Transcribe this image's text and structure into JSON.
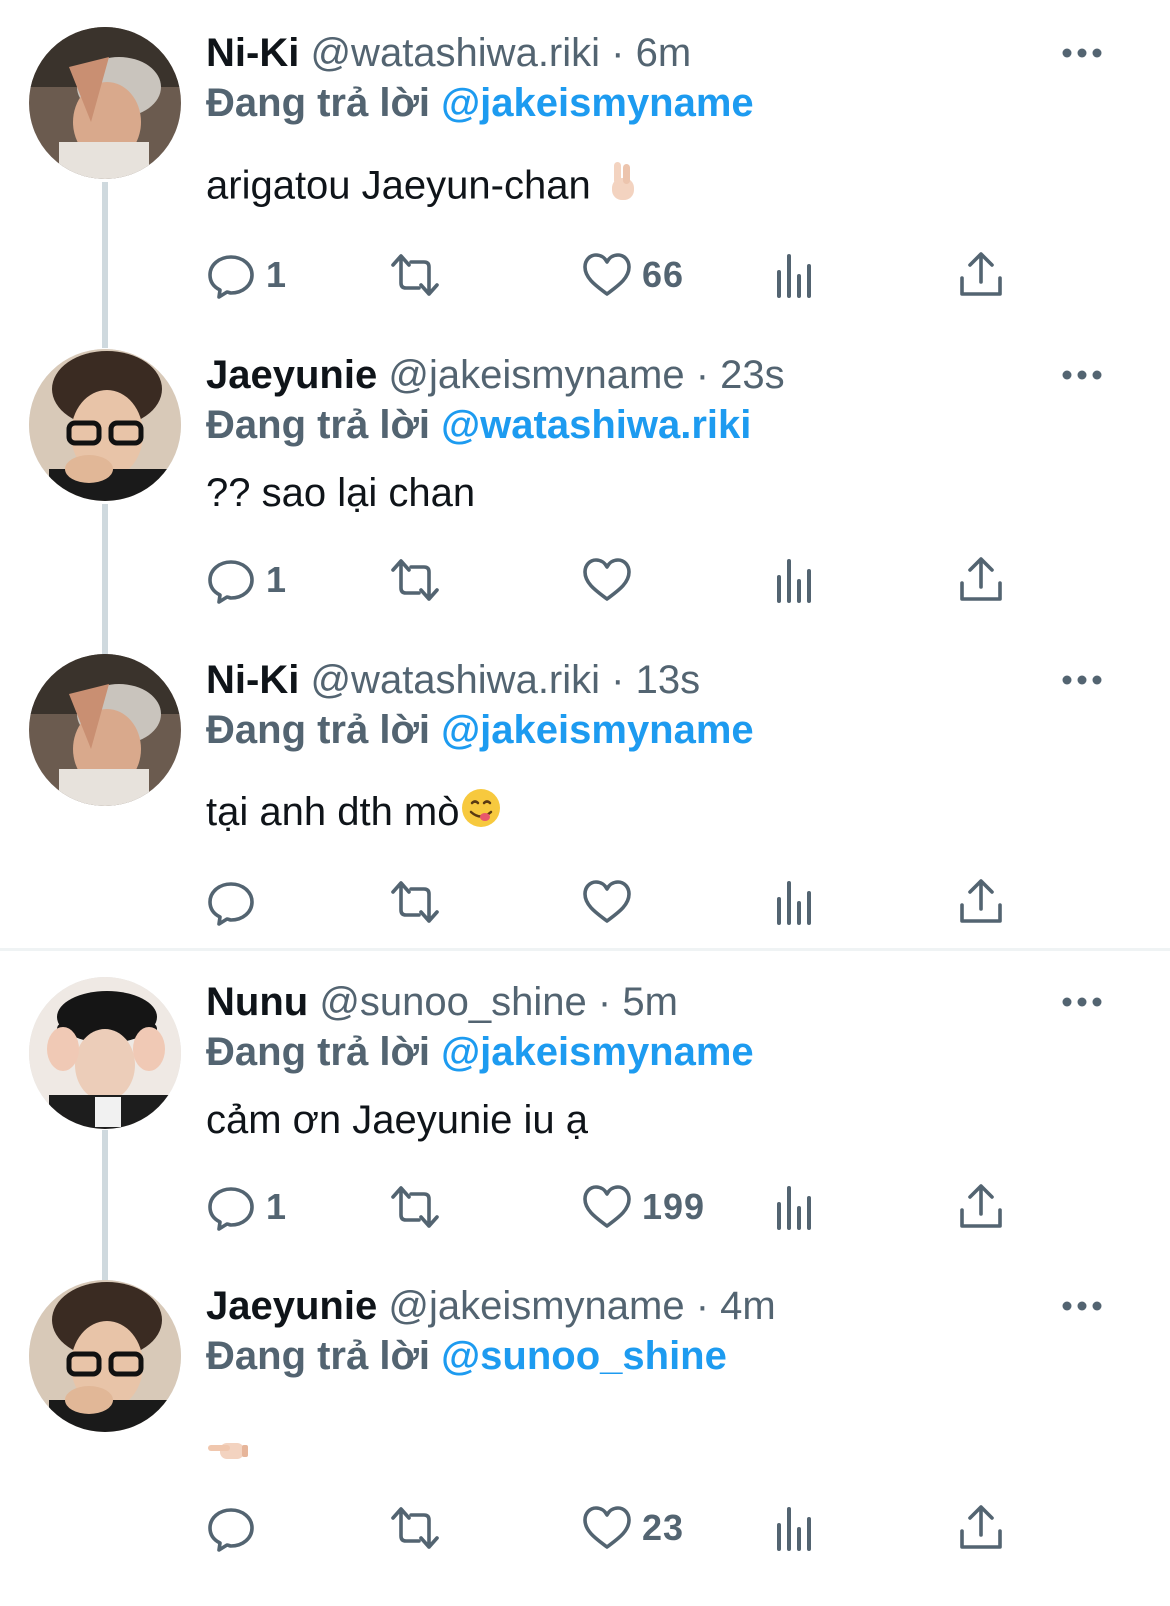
{
  "reply_prefix": "Đang trả lời",
  "accent_color": "#1d9bf0",
  "tweets": [
    {
      "name": "Ni-Ki",
      "handle_time": "@watashiwa.riki · 6m",
      "reply_to": "@jakeismyname",
      "text": "arigatou Jaeyun-chan",
      "emoji": "victory-hand-emoji",
      "counts": {
        "replies": "1",
        "retweets": "",
        "likes": "66"
      }
    },
    {
      "name": "Jaeyunie",
      "handle_time": "@jakeismyname · 23s",
      "reply_to": "@watashiwa.riki",
      "text": "?? sao lại chan",
      "emoji": "",
      "counts": {
        "replies": "1",
        "retweets": "",
        "likes": ""
      }
    },
    {
      "name": "Ni-Ki",
      "handle_time": "@watashiwa.riki · 13s",
      "reply_to": "@jakeismyname",
      "text": "tại anh dth mò",
      "emoji": "yum-face-emoji",
      "counts": {
        "replies": "",
        "retweets": "",
        "likes": ""
      }
    },
    {
      "name": "Nunu",
      "handle_time": "@sunoo_shine · 5m",
      "reply_to": "@jakeismyname",
      "text": "cảm ơn Jaeyunie iu ạ",
      "emoji": "",
      "counts": {
        "replies": "1",
        "retweets": "",
        "likes": "199"
      }
    },
    {
      "name": "Jaeyunie",
      "handle_time": "@jakeismyname · 4m",
      "reply_to": "@sunoo_shine",
      "text": "",
      "emoji": "pointing-hand-emoji",
      "counts": {
        "replies": "",
        "retweets": "",
        "likes": "23"
      }
    }
  ]
}
